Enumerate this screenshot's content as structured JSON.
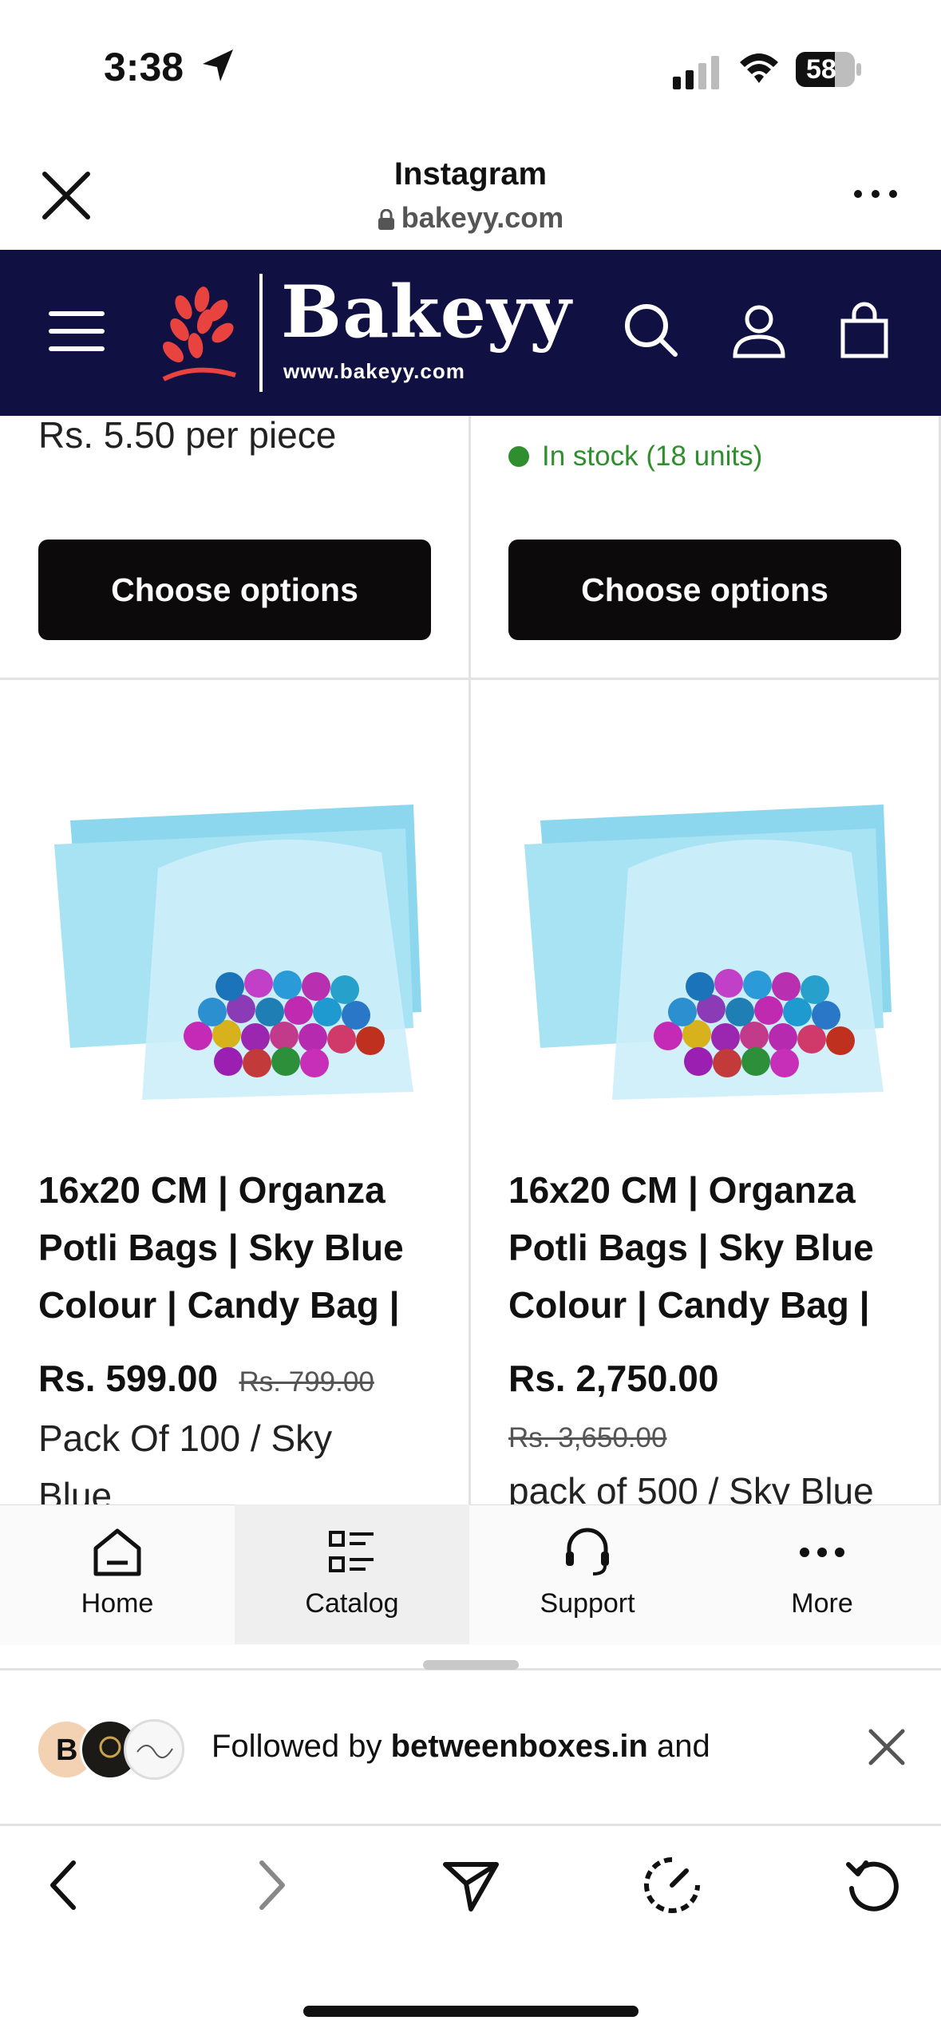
{
  "status_bar": {
    "time": "3:38",
    "battery": "58"
  },
  "browser_header": {
    "title": "Instagram",
    "domain": "bakeyy.com"
  },
  "site": {
    "brand": "Bakeyy",
    "url": "www.bakeyy.com"
  },
  "top_row": {
    "left_price_text": "Rs. 5.50 per piece",
    "right_stock_text": "In stock (18 units)",
    "button_label": "Choose options"
  },
  "products": [
    {
      "title": [
        "16x20 CM | Organza",
        "Potli Bags | Sky Blue",
        "Colour | Candy Bag |"
      ],
      "price": "Rs. 599.00",
      "old_price": "Rs. 799.00",
      "variant": [
        "Pack Of 100 / Sky",
        "Blue"
      ]
    },
    {
      "title": [
        "16x20 CM | Organza",
        "Potli Bags | Sky Blue",
        "Colour | Candy Bag |"
      ],
      "price": "Rs. 2,750.00",
      "old_price": "Rs. 3,650.00",
      "variant": [
        "pack of 500 / Sky Blue"
      ]
    }
  ],
  "tab_bar": [
    {
      "label": "Home",
      "icon": "home-icon"
    },
    {
      "label": "Catalog",
      "icon": "catalog-icon"
    },
    {
      "label": "Support",
      "icon": "headset-icon"
    },
    {
      "label": "More",
      "icon": "more-icon"
    }
  ],
  "follow_bar": {
    "prefix": "Followed by ",
    "account": "betweenboxes.in",
    "suffix": " and"
  },
  "colors": {
    "nav_bg": "#101042",
    "button_bg": "#0c0a0a",
    "stock_green": "#2f8f2f",
    "logo_red": "#e8433f"
  }
}
